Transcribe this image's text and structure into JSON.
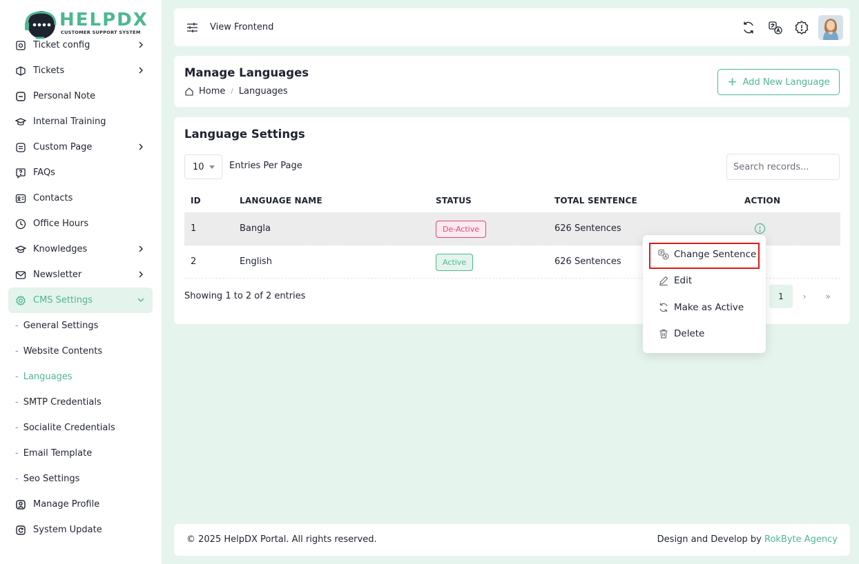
{
  "brand": {
    "name": "HELPDX",
    "tagline": "CUSTOMER SUPPORT SYSTEM"
  },
  "sidebar": {
    "items": [
      {
        "label": "Ticket config",
        "icon": "settings-icon",
        "chevron": true
      },
      {
        "label": "Tickets",
        "icon": "ticket-icon",
        "chevron": true
      },
      {
        "label": "Personal Note",
        "icon": "note-icon",
        "chevron": false
      },
      {
        "label": "Internal Training",
        "icon": "graduation-icon",
        "chevron": false
      },
      {
        "label": "Custom Page",
        "icon": "page-icon",
        "chevron": true
      },
      {
        "label": "FAQs",
        "icon": "question-icon",
        "chevron": false
      },
      {
        "label": "Contacts",
        "icon": "contact-card-icon",
        "chevron": false
      },
      {
        "label": "Office Hours",
        "icon": "clock-icon",
        "chevron": false
      },
      {
        "label": "Knowledges",
        "icon": "knowledge-icon",
        "chevron": true
      },
      {
        "label": "Newsletter",
        "icon": "mail-icon",
        "chevron": true
      },
      {
        "label": "CMS Settings",
        "icon": "gear-icon",
        "chevron": true,
        "active": true
      }
    ],
    "cms_subitems": [
      "General Settings",
      "Website Contents",
      "Languages",
      "SMTP Credentials",
      "Socialite Credentials",
      "Email Template",
      "Seo Settings"
    ],
    "bottom_items": [
      {
        "label": "Manage Profile",
        "icon": "user-profile-icon"
      },
      {
        "label": "System Update",
        "icon": "refresh-icon"
      }
    ]
  },
  "topbar": {
    "view_frontend": "View Frontend",
    "icons": [
      "sync-icon",
      "translate-icon",
      "alert-badge-icon",
      "avatar"
    ]
  },
  "manage": {
    "title": "Manage Languages",
    "breadcrumb_home": "Home",
    "breadcrumb_sep": "/",
    "breadcrumb_current": "Languages",
    "add_button": "Add New Language"
  },
  "settings": {
    "title": "Language Settings",
    "per_page_value": "10",
    "per_page_label": "Entries Per Page",
    "search_placeholder": "Search records...",
    "columns": [
      "ID",
      "LANGUAGE NAME",
      "STATUS",
      "TOTAL SENTENCE",
      "ACTION"
    ],
    "rows": [
      {
        "id": "1",
        "name": "Bangla",
        "status": "De-Active",
        "total": "626 Sentences"
      },
      {
        "id": "2",
        "name": "English",
        "status": "Active",
        "total": "626 Sentences"
      }
    ],
    "showing": "Showing 1 to 2 of 2 entries",
    "pager": {
      "current": "1",
      "next": "›",
      "last": "»"
    }
  },
  "dropdown": {
    "items": [
      "Change Sentence",
      "Edit",
      "Make as Active",
      "Delete"
    ]
  },
  "footer": {
    "copyright": "© 2025 HelpDX Portal. All rights reserved.",
    "credit_prefix": "Design and Develop by ",
    "agency": "RokByte Agency"
  },
  "colors": {
    "accent": "#4cb88e",
    "danger": "#e0457b",
    "highlight": "#e01818",
    "background": "#e6f4ee"
  }
}
